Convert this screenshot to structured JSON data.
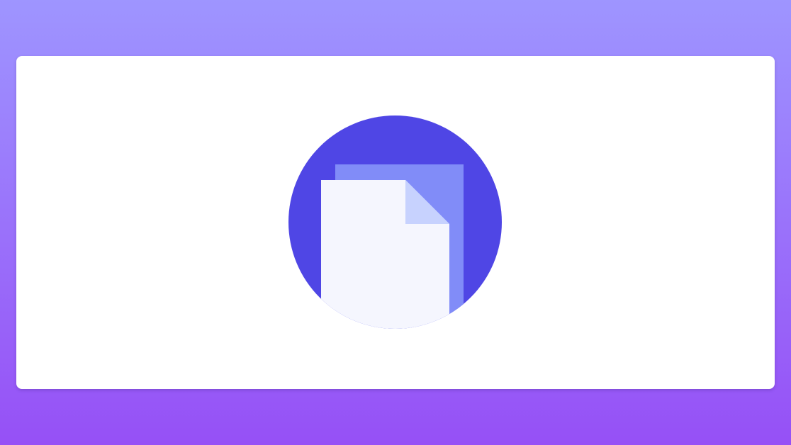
{
  "page": {
    "background_top_color": "#9e95ff",
    "background_bottom_color": "#9650f6"
  },
  "card": {
    "background_color": "#ffffff"
  },
  "illustration": {
    "icon": "document-copy-icon",
    "circle_color": "#4f46e5",
    "back_sheet_color": "#818cf8",
    "front_sheet_color": "#f5f6fe",
    "corner_fold_color": "#c7d2fe"
  }
}
